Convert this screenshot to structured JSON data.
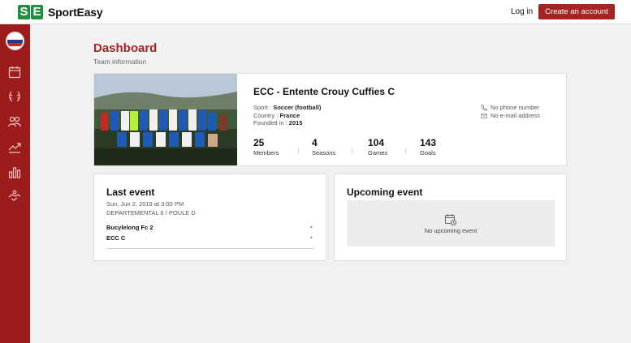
{
  "brand": {
    "logo_letters": [
      "S",
      "E"
    ],
    "name": "SportEasy"
  },
  "topbar": {
    "login_label": "Log in",
    "cta_label": "Create an account"
  },
  "colors": {
    "primary": "#a32421",
    "sidebar": "#9c1b1b",
    "brand_green": "#1f8f43"
  },
  "sidebar": {
    "items": [
      {
        "icon": "calendar-icon"
      },
      {
        "icon": "laurel-icon"
      },
      {
        "icon": "team-members-icon"
      },
      {
        "icon": "trend-chart-icon"
      },
      {
        "icon": "bar-chart-icon"
      },
      {
        "icon": "handshake-icon"
      }
    ]
  },
  "header": {
    "title": "Dashboard",
    "subtitle": "Team information"
  },
  "team": {
    "name": "ECC - Entente Crouy Cuffies C",
    "sport_label": "Sport :",
    "sport_value": "Soccer (football)",
    "country_label": "Country :",
    "country_value": "France",
    "founded_label": "Founded in :",
    "founded_value": "2015",
    "phone": "No phone number",
    "email": "No e-mail address",
    "stats": [
      {
        "value": "25",
        "label": "Members"
      },
      {
        "value": "4",
        "label": "Seasons"
      },
      {
        "value": "104",
        "label": "Games"
      },
      {
        "value": "143",
        "label": "Goals"
      }
    ]
  },
  "last_event": {
    "title": "Last event",
    "date": "Sun, Jun 2, 2019 at 3:00 PM",
    "competition": "DEPARTEMENTAL 6 / POULE D",
    "home_team": "Bucylelong Fc 2",
    "home_score": "-",
    "away_team": "ECC C",
    "away_score": "-"
  },
  "upcoming_event": {
    "title": "Upcoming event",
    "empty_text": "No upcoming event"
  }
}
